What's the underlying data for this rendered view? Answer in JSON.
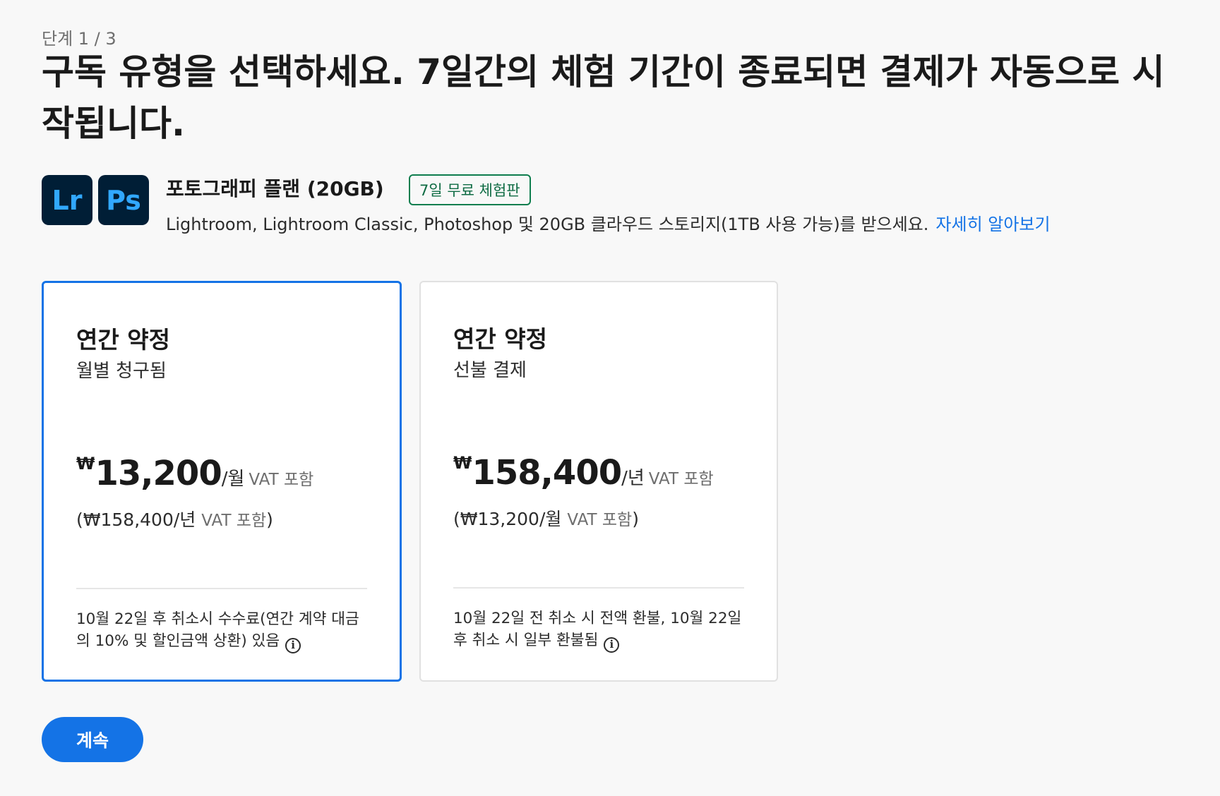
{
  "step": "단계 1 / 3",
  "headline": "구독 유형을 선택하세요. 7일간의 체험 기간이 종료되면 결제가 자동으로 시작됩니다.",
  "plan": {
    "icons": [
      {
        "label": "Lr",
        "icon": "lightroom-app-icon"
      },
      {
        "label": "Ps",
        "icon": "photoshop-app-icon"
      }
    ],
    "name": "포토그래피 플랜 (20GB)",
    "trial_badge": "7일 무료 체험판",
    "description": "Lightroom, Lightroom Classic, Photoshop 및 20GB 클라우드 스토리지(1TB 사용 가능)를 받으세요.",
    "learn_more": "자세히 알아보기"
  },
  "cards": [
    {
      "selected": true,
      "title": "연간 약정",
      "subtitle": "월별 청구됨",
      "currency": "₩",
      "amount": "13,200",
      "period": "/월",
      "vat": "VAT 포함",
      "alt_price_prefix": "(₩158,400/년",
      "alt_price_vat": "VAT 포함",
      "alt_price_suffix": ")",
      "note": "10월 22일 후 취소시 수수료(연간 계약 대금의 10% 및 할인금액 상환) 있음"
    },
    {
      "selected": false,
      "title": "연간 약정",
      "subtitle": "선불 결제",
      "currency": "₩",
      "amount": "158,400",
      "period": "/년",
      "vat": "VAT 포함",
      "alt_price_prefix": "(₩13,200/월",
      "alt_price_vat": "VAT 포함",
      "alt_price_suffix": ")",
      "note": "10월 22일 전 취소 시 전액 환불, 10월 22일 후 취소 시 일부 환불됨"
    }
  ],
  "continue_label": "계속",
  "colors": {
    "accent": "#1473e6",
    "trial_badge": "#0e7e4e",
    "app_icon_bg": "#001e36",
    "app_icon_fg": "#31a8ff"
  }
}
